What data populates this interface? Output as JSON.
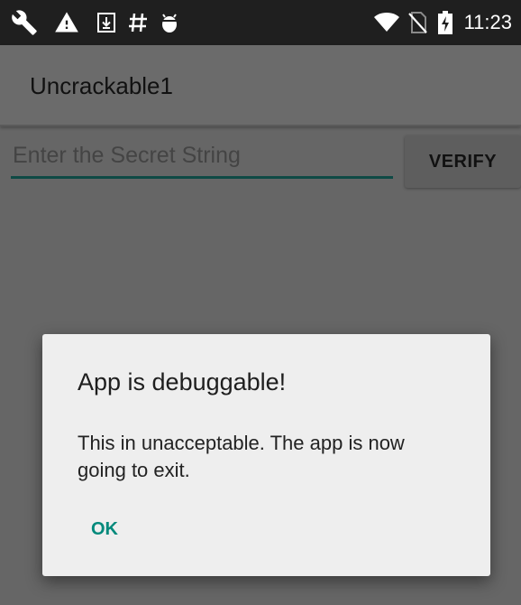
{
  "status_bar": {
    "time": "11:23",
    "icons": [
      "wrench-icon",
      "warning-icon",
      "download-icon",
      "hash-icon",
      "android-debug-icon",
      "wifi-icon",
      "no-sim-icon",
      "battery-charging-icon"
    ]
  },
  "app_bar": {
    "title": "Uncrackable1"
  },
  "main": {
    "secret_input": {
      "value": "",
      "placeholder": "Enter the Secret String"
    },
    "verify_label": "VERIFY"
  },
  "dialog": {
    "title": "App is debuggable!",
    "message": "This in unacceptable. The app is now going to exit.",
    "ok_label": "OK"
  },
  "colors": {
    "accent": "#00897b",
    "input_underline": "#0f4a45",
    "scrim_background": "#666666",
    "status_bar": "#1f1f1f"
  }
}
